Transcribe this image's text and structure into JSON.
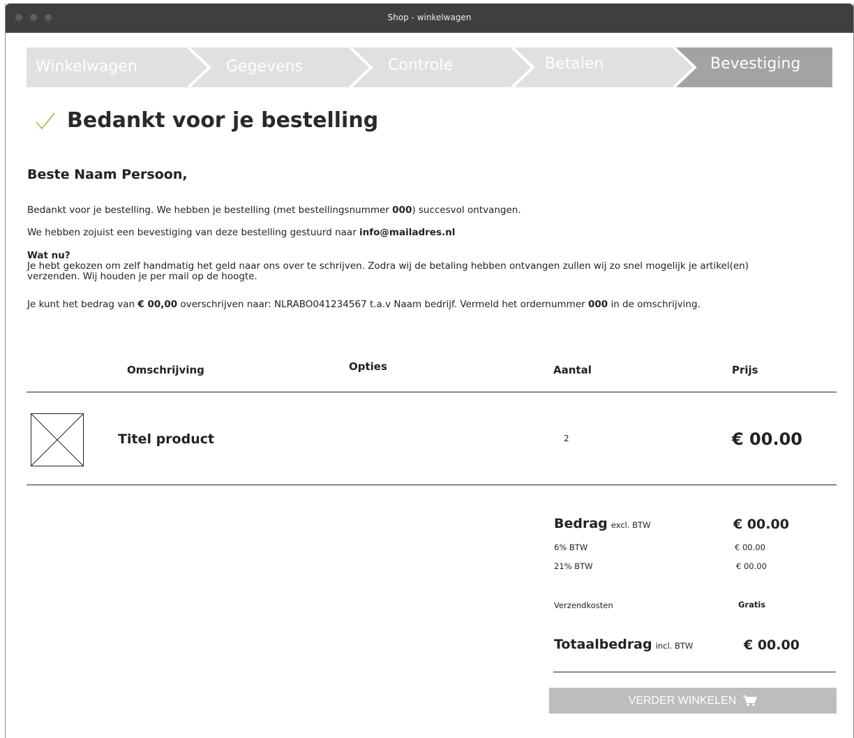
{
  "window": {
    "title": "Shop - winkelwagen"
  },
  "steps": [
    "Winkelwagen",
    "Gegevens",
    "Controle",
    "Betalen",
    "Bevestiging"
  ],
  "heading": "Bedankt voor je bestelling",
  "greeting": "Beste Naam Persoon,",
  "messages": {
    "line1_a": "Bedankt voor je bestelling. We hebben je bestelling (met bestellingsnummer ",
    "line1_b": "000",
    "line1_c": ") succesvol ontvangen.",
    "line2_a": "We hebben zojuist een bevestiging van deze bestelling gestuurd naar ",
    "line2_b": "info@mailadres.nl",
    "wat_nu": "Wat nu?",
    "line3": "Je hebt gekozen om zelf handmatig het geld naar ons over te schrijven. Zodra wij de betaling hebben ontvangen zullen wij zo snel mogelijk je artikel(en)",
    "line3b": "verzenden. Wij houden je per mail op de hoogte.",
    "line4_a": "Je kunt het bedrag van ",
    "line4_b": "€ 00,00",
    "line4_c": " overschrijven naar: NLRABO041234567 t.a.v Naam bedrijf. Vermeld het ordernummer ",
    "line4_d": "000",
    "line4_e": " in de omschrijving."
  },
  "table": {
    "headers": [
      "Omschrijving",
      "Opties",
      "Aantal",
      "Prijs"
    ],
    "rows": [
      {
        "title": "Titel product",
        "qty": "2",
        "price": "€ 00.00"
      }
    ]
  },
  "summary": {
    "bedrag_label": "Bedrag",
    "bedrag_suffix": "excl. BTW",
    "bedrag_value": "€ 00.00",
    "btw6_label": "6% BTW",
    "btw6_value": "€ 00.00",
    "btw21_label": "21% BTW",
    "btw21_value": "€ 00.00",
    "verzend_label": "Verzendkosten",
    "verzend_value": "Gratis",
    "totaal_label": "Totaalbedrag",
    "totaal_suffix": "incl. BTW",
    "totaal_value": "€ 00.00"
  },
  "button": {
    "label": "VERDER WINKELEN"
  },
  "colors": {
    "step_inactive": "#e0e0e0",
    "step_active": "#a3a3a3",
    "check": "#8bc34a",
    "button": "#bdbdbd"
  }
}
